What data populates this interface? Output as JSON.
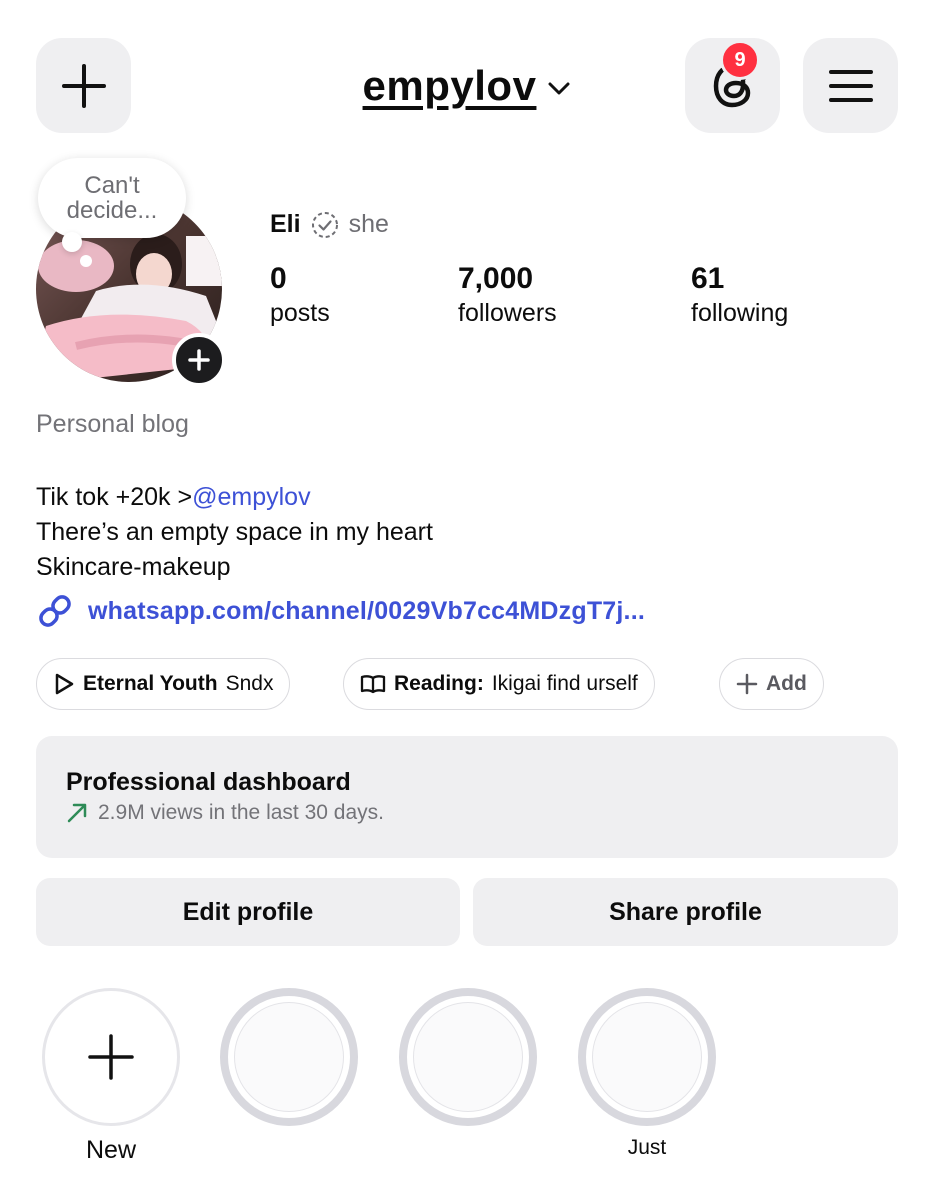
{
  "header": {
    "username": "empylov",
    "notification_count": "9"
  },
  "profile": {
    "thought_bubble": "Can't decide...",
    "name": "Eli",
    "pronoun": "she",
    "stats": [
      {
        "value": "0",
        "label": "posts"
      },
      {
        "value": "7,000",
        "label": "followers"
      },
      {
        "value": "61",
        "label": "following"
      }
    ],
    "category": "Personal blog",
    "bio_line1_prefix": "Tik tok +20k  >",
    "bio_line1_mention": "@empylov",
    "bio_line2": "There’s an empty space in my heart",
    "bio_line3": "Skincare-makeup",
    "link": "whatsapp.com/channel/0029Vb7cc4MDzgT7j..."
  },
  "chips": {
    "music_title": "Eternal Youth",
    "music_artist": "Sndx",
    "reading_label": "Reading:",
    "reading_value": "Ikigai find urself",
    "add_label": "Add"
  },
  "dashboard": {
    "title": "Professional dashboard",
    "subtitle": "2.9M views in the last 30 days.",
    "trend_color": "#2e8b57"
  },
  "actions": {
    "edit": "Edit profile",
    "share": "Share profile"
  },
  "highlights": [
    {
      "label": "New"
    },
    {
      "label": ""
    },
    {
      "label": ""
    },
    {
      "label": "Just"
    }
  ],
  "colors": {
    "accent_link": "#3d51d6",
    "badge": "#ff3040",
    "button_bg": "#efeff1"
  }
}
